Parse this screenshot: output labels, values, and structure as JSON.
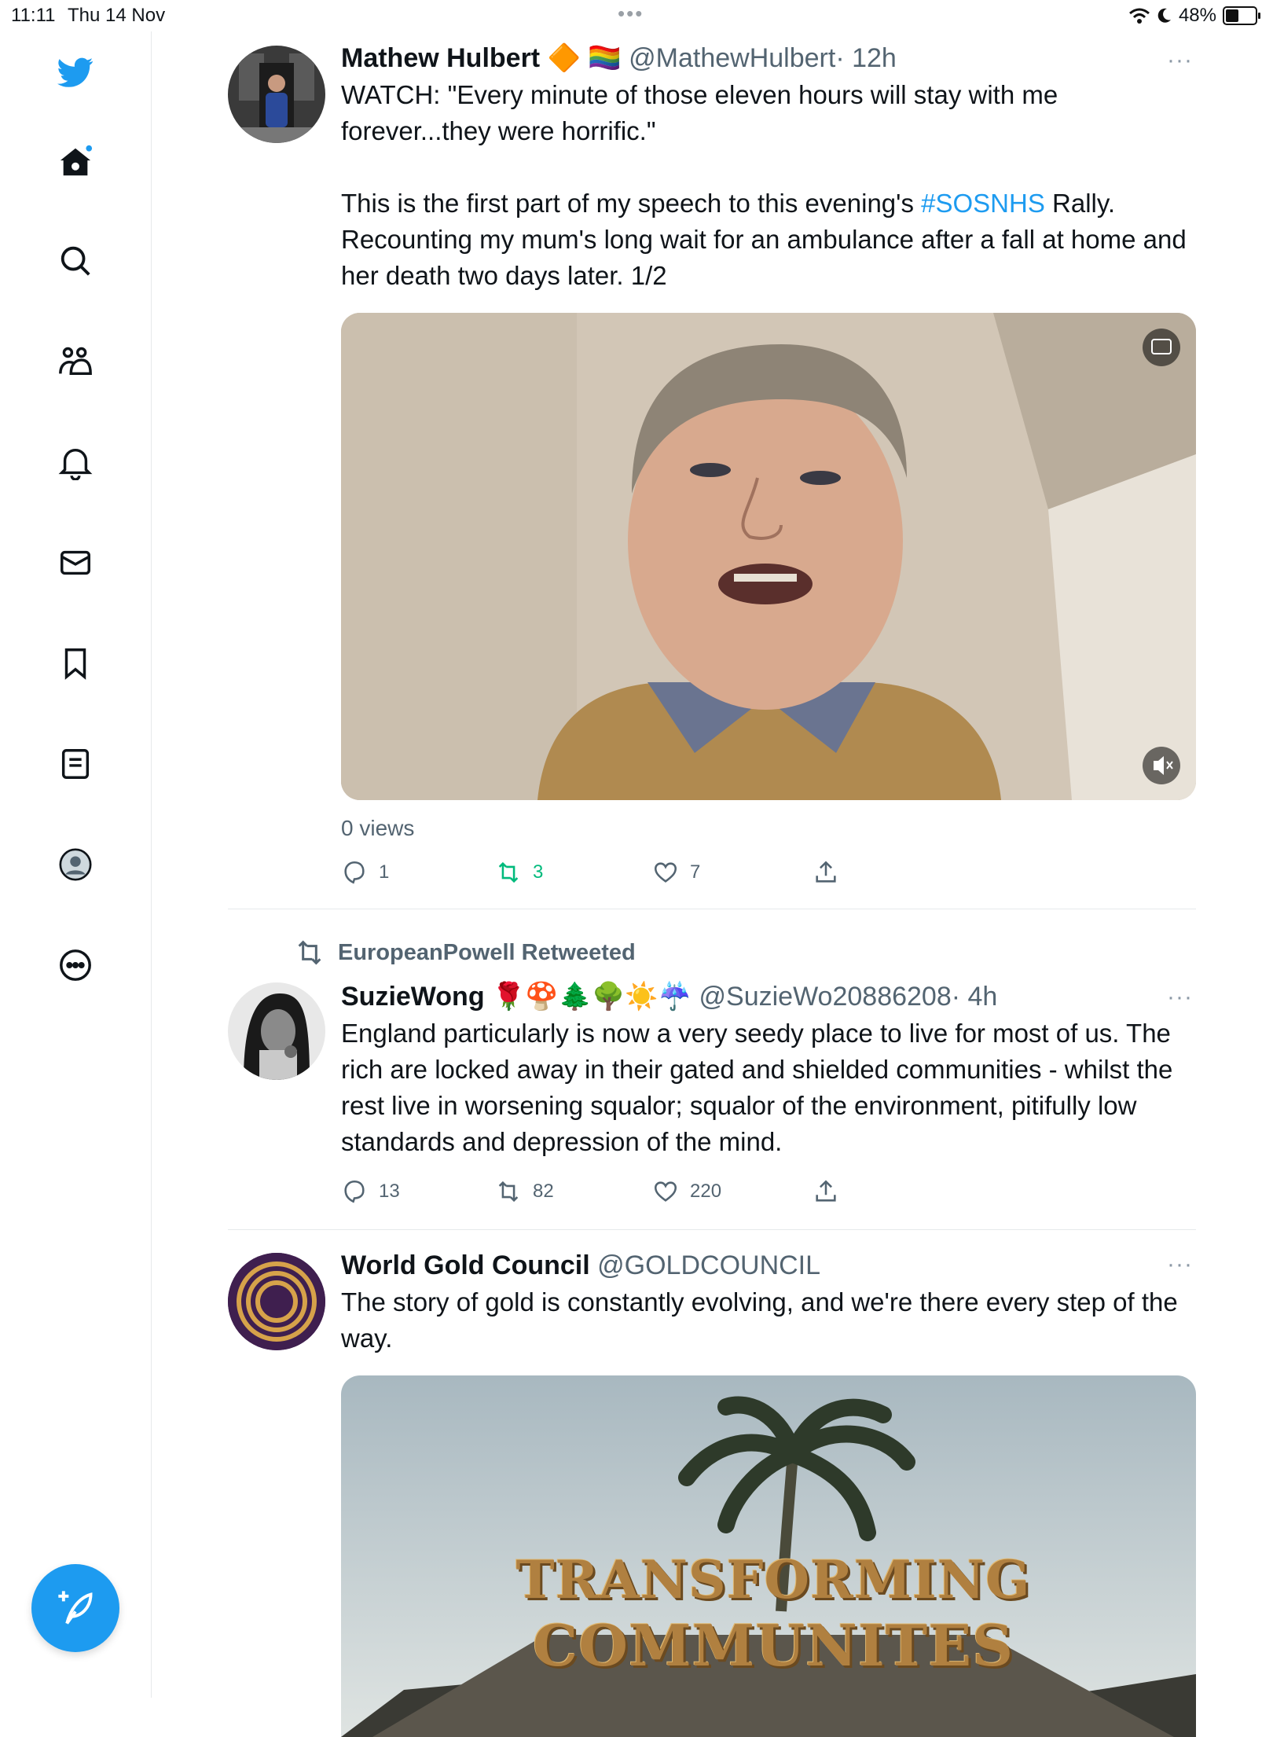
{
  "status_bar": {
    "time": "11:11",
    "date": "Thu 14 Nov",
    "battery": "48%"
  },
  "sidebar": {
    "items": [
      {
        "icon": "twitter-logo-icon"
      },
      {
        "icon": "home-icon"
      },
      {
        "icon": "search-icon"
      },
      {
        "icon": "communities-icon"
      },
      {
        "icon": "bell-icon"
      },
      {
        "icon": "mail-icon"
      },
      {
        "icon": "bookmark-icon"
      },
      {
        "icon": "lists-icon"
      },
      {
        "icon": "profile-icon"
      },
      {
        "icon": "more-icon"
      }
    ],
    "accent": "#1d9bf0"
  },
  "tweets": [
    {
      "name": "Mathew Hulbert",
      "badges": "🔶 🏳️‍🌈",
      "handle": "@MathewHulbert",
      "time": "· 12h",
      "text1": "WATCH: \"Every minute of those eleven hours will stay with me forever...they were horrific.\"",
      "text2a": "This is the first part of my speech to this evening's ",
      "hashtag": "#SOSNHS",
      "text2b": " Rally. Recounting my mum's long wait for an ambulance after a fall at home and her death two days later. 1/2",
      "views": "0 views",
      "replies": "1",
      "retweets": "3",
      "likes": "7"
    },
    {
      "retweeted_by": "EuropeanPowell Retweeted",
      "name": "SuzieWong",
      "badges": "🌹🍄🌲🌳☀️☔",
      "handle": "@SuzieWo20886208",
      "time": "· 4h",
      "text": "England particularly is now a very seedy place to live for most of us. The rich are locked away in their gated and shielded communities - whilst the rest live in worsening squalor; squalor of the environment, pitifully low standards and depression of the mind.",
      "replies": "13",
      "retweets": "82",
      "likes": "220"
    },
    {
      "name": "World Gold Council",
      "handle": "@GOLDCOUNCIL",
      "text": "The story of gold is constantly evolving, and we're there every step of the way.",
      "image_line1": "TRANSFORMING",
      "image_line2": "COMMUNITES"
    }
  ],
  "more_glyph": "···",
  "retweet_color": "#00ba7c"
}
